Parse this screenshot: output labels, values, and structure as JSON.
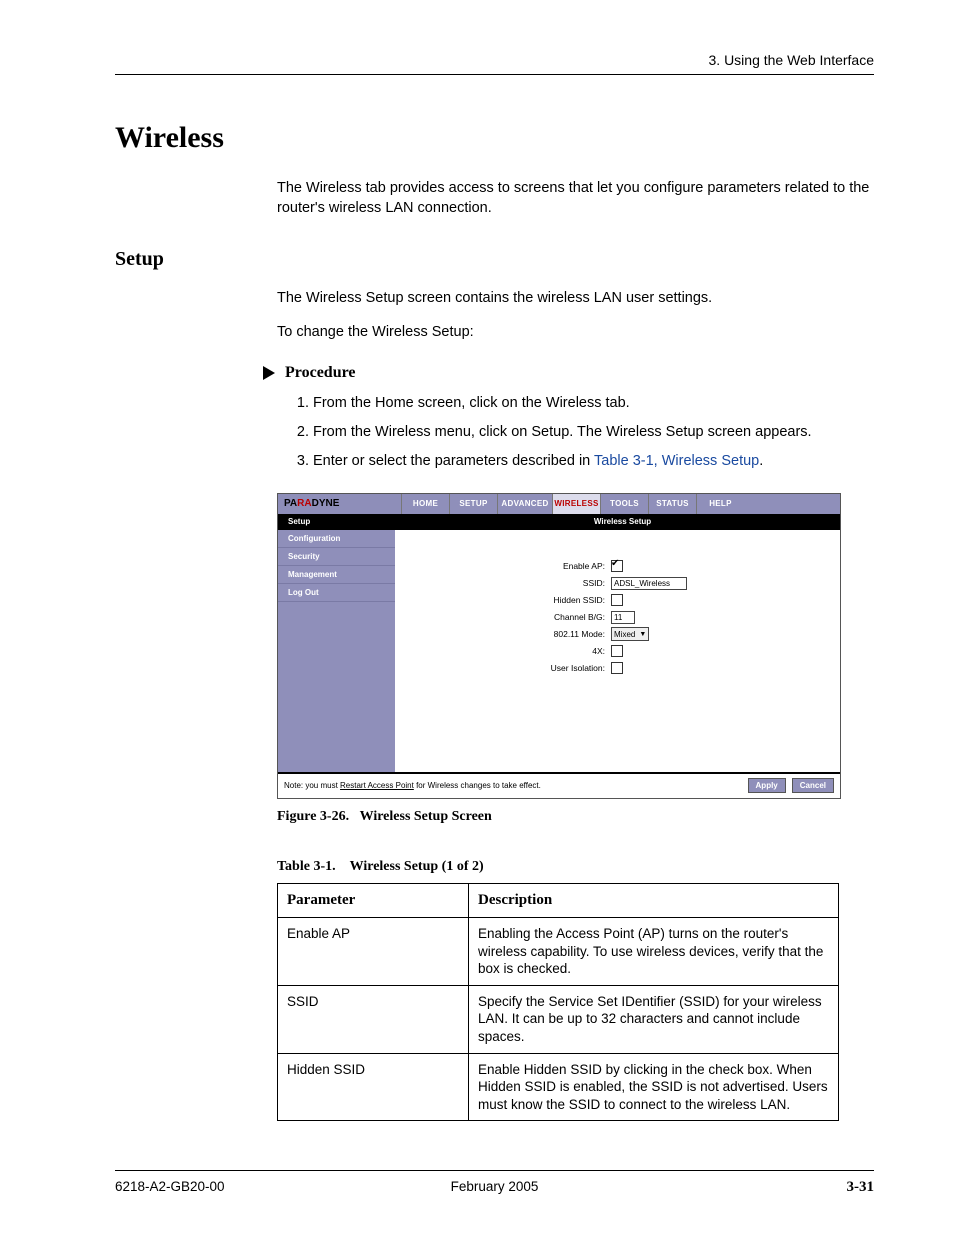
{
  "header": {
    "chapter": "3. Using the Web Interface"
  },
  "title": "Wireless",
  "intro": "The Wireless tab provides access to screens that let you configure parameters related to the router's wireless LAN connection.",
  "section": "Setup",
  "setup_p1": "The Wireless Setup screen contains the wireless LAN user settings.",
  "setup_p2": "To change the Wireless Setup:",
  "procedure_label": "Procedure",
  "steps": {
    "s1": "From the Home screen, click on the Wireless tab.",
    "s2": "From the Wireless menu, click on Setup. The Wireless Setup screen appears.",
    "s3a": "Enter or select the parameters described in ",
    "s3_link": "Table 3-1, Wireless Setup",
    "s3b": "."
  },
  "screenshot": {
    "brand_pre": "PA",
    "brand_mid": "RA",
    "brand_post": "DYNE",
    "tabs": {
      "home": "HOME",
      "setup": "SETUP",
      "advanced": "ADVANCED",
      "wireless": "WIRELESS",
      "tools": "TOOLS",
      "status": "STATUS",
      "help": "HELP"
    },
    "black_left": "Setup",
    "black_mid": "Wireless Setup",
    "sidebar": {
      "i0": "Configuration",
      "i1": "Security",
      "i2": "Management",
      "i3": "Log Out"
    },
    "fields": {
      "enable_ap": "Enable AP:",
      "ssid": "SSID:",
      "ssid_val": "ADSL_Wireless",
      "hidden": "Hidden SSID:",
      "channel": "Channel B/G:",
      "channel_val": "11",
      "mode": "802.11 Mode:",
      "mode_val": "Mixed",
      "fourx": "4X:",
      "iso": "User Isolation:"
    },
    "footer_note_a": "Note: you must ",
    "footer_note_link": "Restart Access Point",
    "footer_note_b": " for Wireless changes to take effect.",
    "apply": "Apply",
    "cancel": "Cancel"
  },
  "figure": {
    "num": "Figure 3-26.",
    "title": "Wireless Setup Screen"
  },
  "table_caption": {
    "num": "Table 3-1.",
    "title": "Wireless Setup (1 of 2)"
  },
  "table": {
    "h1": "Parameter",
    "h2": "Description",
    "r1p": "Enable AP",
    "r1d": "Enabling the Access Point (AP) turns on the router's wireless capability. To use wireless devices, verify that the box is checked.",
    "r2p": "SSID",
    "r2d": "Specify the Service Set IDentifier (SSID) for your wireless LAN. It can be up to 32 characters and cannot include spaces.",
    "r3p": "Hidden SSID",
    "r3d": "Enable Hidden SSID by clicking in the check box. When Hidden SSID is enabled, the SSID is not advertised. Users must know the SSID to connect to the wireless LAN."
  },
  "footer": {
    "doc": "6218-A2-GB20-00",
    "date": "February 2005",
    "page": "3-31"
  }
}
